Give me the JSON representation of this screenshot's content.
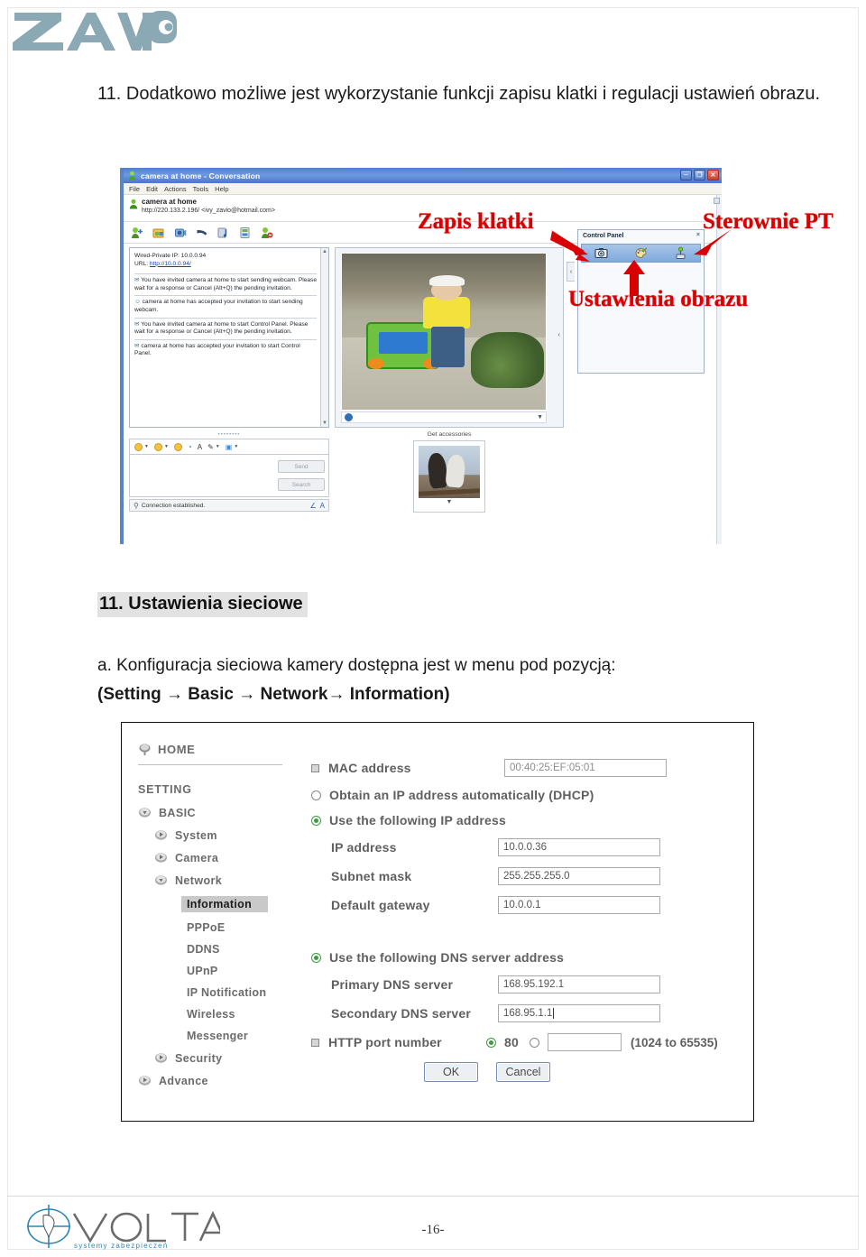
{
  "brand": {
    "logo_text": "ZAVIO",
    "logo_color": "#8ba8b5"
  },
  "intro": {
    "text": "11. Dodatkowo możliwe jest wykorzystanie funkcji zapisu klatki i regulacji ustawień obrazu."
  },
  "messenger": {
    "title": "camera at home - Conversation",
    "window_buttons": {
      "minimize": "─",
      "maximize": "❐",
      "close": "✕"
    },
    "menu": [
      "File",
      "Edit",
      "Actions",
      "Tools",
      "Help"
    ],
    "contact": {
      "name": "camera at home",
      "url": "http://220.133.2.196/ <ivy_zavio@hotmail.com>"
    },
    "conversation": {
      "header_ip": "Wired-Private IP: 10.0.0.94",
      "header_url_label": "URL:",
      "header_url": "http://10.0.0.94/",
      "messages": [
        "You have invited camera at home to start sending webcam. Please wait for a response or Cancel (Alt+Q) the pending invitation.",
        "camera at home has accepted your invitation to start sending webcam.",
        "You have invited camera at home to start Control Panel. Please wait for a response or Cancel (Alt+Q) the pending invitation.",
        "camera at home has accepted your invitation to start Control Panel."
      ]
    },
    "accessories_label": "Get accessories",
    "control_panel": {
      "title": "Control Panel",
      "close": "×",
      "icons": [
        "snapshot-camera-icon",
        "color-palette-icon",
        "joystick-pt-icon"
      ]
    },
    "compose": {
      "send_label": "Send",
      "search_label": "Search"
    },
    "status": "Connection established."
  },
  "annotations": {
    "save_frame": "Zapis klatki",
    "pt_control": "Sterownie PT",
    "image_settings": "Ustawienia obrazu",
    "color": "#d80000"
  },
  "section": {
    "heading": "11. Ustawienia sieciowe",
    "paragraph_prefix": "a. Konfiguracja sieciowa kamery dostępna jest w menu pod pozycją:",
    "path_open": "(",
    "path": "Setting → Basic → Network→ Information",
    "path_close": ")"
  },
  "settings_ui": {
    "sidebar": {
      "home_label": "HOME",
      "section_label": "SETTING",
      "basic_label": "BASIC",
      "items": [
        {
          "label": "System",
          "level": 2,
          "icon": "disc-right-icon"
        },
        {
          "label": "Camera",
          "level": 2,
          "icon": "disc-right-icon"
        },
        {
          "label": "Network",
          "level": 2,
          "icon": "disc-down-icon"
        }
      ],
      "network_children": [
        "Information",
        "PPPoE",
        "DDNS",
        "UPnP",
        "IP Notification",
        "Wireless",
        "Messenger"
      ],
      "active_child": "Information",
      "tail_items": [
        {
          "label": "Security",
          "level": 2,
          "icon": "disc-right-icon"
        },
        {
          "label": "Advance",
          "level": 1,
          "icon": "disc-right-icon"
        }
      ]
    },
    "form": {
      "mac_label": "MAC address",
      "mac_value": "00:40:25:EF:05:01",
      "dhcp_option": "Obtain an IP address automatically (DHCP)",
      "static_option": "Use the following IP address",
      "ip_label": "IP address",
      "ip_value": "10.0.0.36",
      "subnet_label": "Subnet mask",
      "subnet_value": "255.255.255.0",
      "gateway_label": "Default gateway",
      "gateway_value": "10.0.0.1",
      "dns_option": "Use the following DNS server address",
      "dns1_label": "Primary DNS server",
      "dns1_value": "168.95.192.1",
      "dns2_label": "Secondary DNS server",
      "dns2_value": "168.95.1.1",
      "http_port_label": "HTTP port number",
      "http_port_default": "80",
      "http_port_custom": "",
      "http_port_hint": "(1024 to 65535)",
      "ok_label": "OK",
      "cancel_label": "Cancel"
    }
  },
  "footer": {
    "company": "VOLTA",
    "tagline": "systemy zabezpieczeń",
    "page_number": "-16-"
  }
}
